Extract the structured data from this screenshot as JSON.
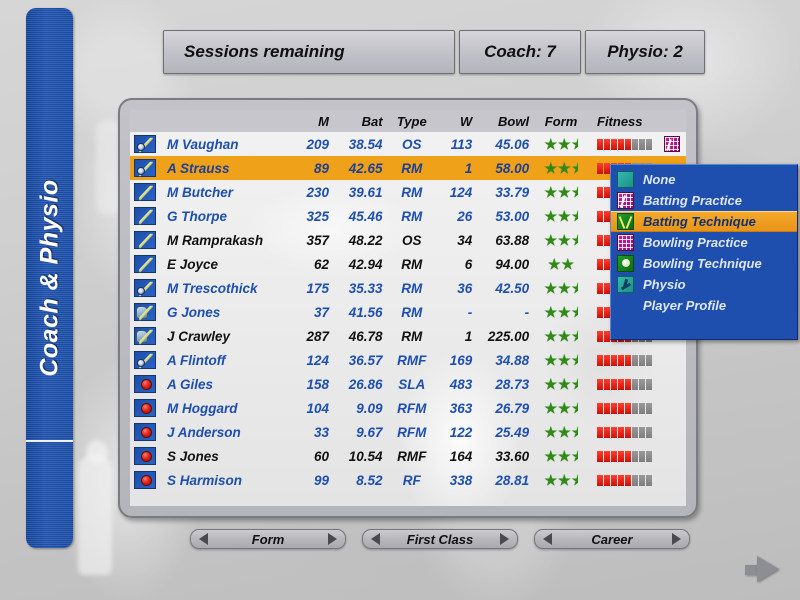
{
  "sidebar": {
    "label": "Coach & Physio"
  },
  "topbar": {
    "sessions_label": "Sessions remaining",
    "coach_label": "Coach: 7",
    "physio_label": "Physio: 2"
  },
  "table": {
    "headers": {
      "icon": "",
      "name": "",
      "m": "M",
      "bat": "Bat",
      "type": "Type",
      "w": "W",
      "bowl": "Bowl",
      "form": "Form",
      "fitness": "Fitness"
    },
    "rows": [
      {
        "name": "M Vaughan",
        "m": "209",
        "bat": "38.54",
        "type": "OS",
        "w": "113",
        "bowl": "45.06",
        "form": 2.5,
        "fitness_on": 5,
        "fitness_off": 3,
        "assigned": "batting-practice",
        "icon": "allrounder",
        "dark": false,
        "selected": false
      },
      {
        "name": "A Strauss",
        "m": "89",
        "bat": "42.65",
        "type": "RM",
        "w": "1",
        "bowl": "58.00",
        "form": 2.5,
        "fitness_on": 5,
        "fitness_off": 3,
        "assigned": "",
        "icon": "allrounder",
        "dark": false,
        "selected": true
      },
      {
        "name": "M Butcher",
        "m": "230",
        "bat": "39.61",
        "type": "RM",
        "w": "124",
        "bowl": "33.79",
        "form": 2.5,
        "fitness_on": 5,
        "fitness_off": 3,
        "assigned": "",
        "icon": "bat",
        "dark": false,
        "selected": false
      },
      {
        "name": "G Thorpe",
        "m": "325",
        "bat": "45.46",
        "type": "RM",
        "w": "26",
        "bowl": "53.00",
        "form": 2.5,
        "fitness_on": 5,
        "fitness_off": 3,
        "assigned": "",
        "icon": "bat",
        "dark": false,
        "selected": false
      },
      {
        "name": "M Ramprakash",
        "m": "357",
        "bat": "48.22",
        "type": "OS",
        "w": "34",
        "bowl": "63.88",
        "form": 2.5,
        "fitness_on": 5,
        "fitness_off": 3,
        "assigned": "",
        "icon": "bat",
        "dark": true,
        "selected": false
      },
      {
        "name": "E Joyce",
        "m": "62",
        "bat": "42.94",
        "type": "RM",
        "w": "6",
        "bowl": "94.00",
        "form": 2.0,
        "fitness_on": 5,
        "fitness_off": 3,
        "assigned": "",
        "icon": "bat",
        "dark": true,
        "selected": false
      },
      {
        "name": "M Trescothick",
        "m": "175",
        "bat": "35.33",
        "type": "RM",
        "w": "36",
        "bowl": "42.50",
        "form": 2.5,
        "fitness_on": 5,
        "fitness_off": 3,
        "assigned": "",
        "icon": "allrounder",
        "dark": false,
        "selected": false
      },
      {
        "name": "G Jones",
        "m": "37",
        "bat": "41.56",
        "type": "RM",
        "w": "-",
        "bowl": "-",
        "form": 2.5,
        "fitness_on": 5,
        "fitness_off": 3,
        "assigned": "",
        "icon": "keeper",
        "dark": false,
        "selected": false
      },
      {
        "name": "J Crawley",
        "m": "287",
        "bat": "46.78",
        "type": "RM",
        "w": "1",
        "bowl": "225.00",
        "form": 2.5,
        "fitness_on": 5,
        "fitness_off": 3,
        "assigned": "",
        "icon": "keeper",
        "dark": true,
        "selected": false
      },
      {
        "name": "A Flintoff",
        "m": "124",
        "bat": "36.57",
        "type": "RMF",
        "w": "169",
        "bowl": "34.88",
        "form": 2.5,
        "fitness_on": 5,
        "fitness_off": 3,
        "assigned": "",
        "icon": "allrounder",
        "dark": false,
        "selected": false
      },
      {
        "name": "A Giles",
        "m": "158",
        "bat": "26.86",
        "type": "SLA",
        "w": "483",
        "bowl": "28.73",
        "form": 2.5,
        "fitness_on": 5,
        "fitness_off": 3,
        "assigned": "",
        "icon": "bowler",
        "dark": false,
        "selected": false
      },
      {
        "name": "M Hoggard",
        "m": "104",
        "bat": "9.09",
        "type": "RFM",
        "w": "363",
        "bowl": "26.79",
        "form": 2.5,
        "fitness_on": 5,
        "fitness_off": 3,
        "assigned": "",
        "icon": "bowler",
        "dark": false,
        "selected": false
      },
      {
        "name": "J Anderson",
        "m": "33",
        "bat": "9.67",
        "type": "RFM",
        "w": "122",
        "bowl": "25.49",
        "form": 2.5,
        "fitness_on": 5,
        "fitness_off": 3,
        "assigned": "",
        "icon": "bowler",
        "dark": false,
        "selected": false
      },
      {
        "name": "S Jones",
        "m": "60",
        "bat": "10.54",
        "type": "RMF",
        "w": "164",
        "bowl": "33.60",
        "form": 2.5,
        "fitness_on": 5,
        "fitness_off": 3,
        "assigned": "",
        "icon": "bowler",
        "dark": true,
        "selected": false
      },
      {
        "name": "S Harmison",
        "m": "99",
        "bat": "8.52",
        "type": "RF",
        "w": "338",
        "bowl": "28.81",
        "form": 2.5,
        "fitness_on": 5,
        "fitness_off": 3,
        "assigned": "",
        "icon": "bowler",
        "dark": false,
        "selected": false
      }
    ]
  },
  "context_menu": {
    "items": [
      {
        "label": "None",
        "icon": "ic-none",
        "active": false
      },
      {
        "label": "Batting Practice",
        "icon": "ic-batprac",
        "active": false
      },
      {
        "label": "Batting Technique",
        "icon": "ic-battech",
        "active": true
      },
      {
        "label": "Bowling Practice",
        "icon": "ic-bowlprac",
        "active": false
      },
      {
        "label": "Bowling Technique",
        "icon": "ic-bowltech",
        "active": false
      },
      {
        "label": "Physio",
        "icon": "ic-physio",
        "active": false
      },
      {
        "label": "Player Profile",
        "icon": "",
        "active": false
      }
    ]
  },
  "spinners": [
    {
      "label": "Form"
    },
    {
      "label": "First Class"
    },
    {
      "label": "Career"
    }
  ],
  "colors": {
    "accent_blue": "#1d4fb0",
    "highlight_orange": "#f0a11a",
    "menu_blue": "#1f4fae",
    "star_green": "#2e8b13",
    "fitness_red": "#cc1008",
    "fitness_gray": "#7d7d7d"
  }
}
